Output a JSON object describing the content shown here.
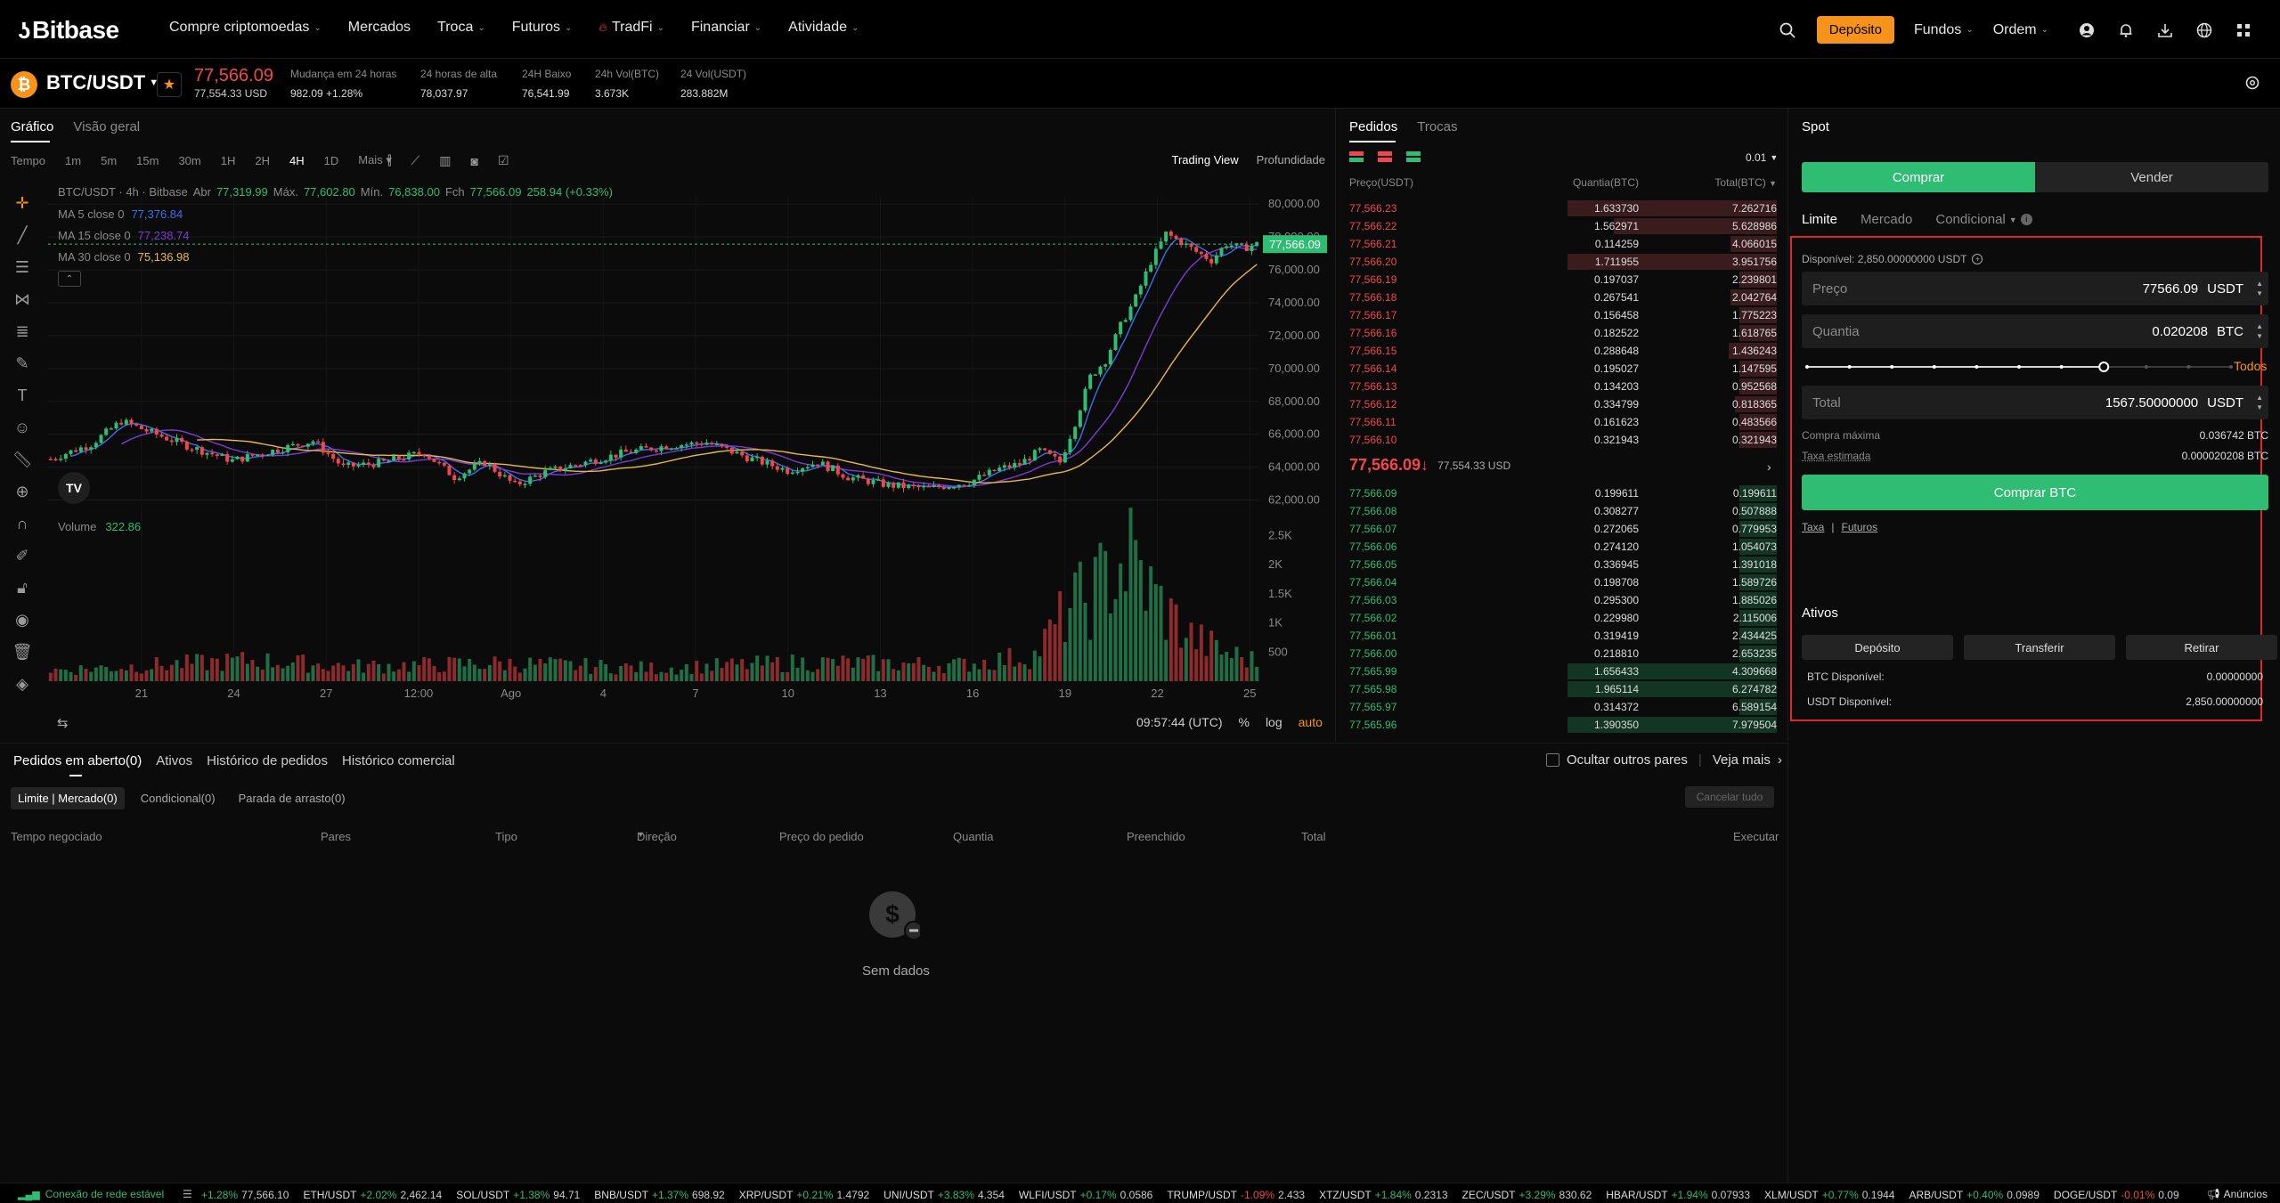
{
  "nav": {
    "logo": "Bitbase",
    "menu": [
      {
        "label": "Compre criptomoedas",
        "chevron": true
      },
      {
        "label": "Mercados",
        "chevron": false
      },
      {
        "label": "Troca",
        "chevron": true
      },
      {
        "label": "Futuros",
        "chevron": true
      },
      {
        "label": "TradFi",
        "chevron": true
      },
      {
        "label": "Financiar",
        "chevron": true
      },
      {
        "label": "Atividade",
        "chevron": true
      }
    ],
    "deposit_label": "Depósito",
    "funds_label": "Fundos",
    "order_label": "Ordem"
  },
  "ticker": {
    "pair": "BTC/USDT",
    "last_price": "77,566.09",
    "last_usd": "77,554.33 USD",
    "stats": [
      {
        "label": "Mudança em 24 horas",
        "value": "982.09 +1.28%",
        "color": "green"
      },
      {
        "label": "24 horas de alta",
        "value": "78,037.97",
        "color": "normal"
      },
      {
        "label": "24H Baixo",
        "value": "76,541.99",
        "color": "normal"
      },
      {
        "label": "24h Vol(BTC)",
        "value": "3.673K",
        "color": "normal"
      },
      {
        "label": "24 Vol(USDT)",
        "value": "283.882M",
        "color": "normal"
      }
    ]
  },
  "chart_panel": {
    "tabs": [
      "Gráfico",
      "Visão geral"
    ],
    "intervals": [
      "Tempo",
      "1m",
      "5m",
      "15m",
      "30m",
      "1H",
      "2H",
      "4H",
      "1D",
      "Mais"
    ],
    "active_interval": "4H",
    "views": [
      "Trading View",
      "Profundidade"
    ],
    "ohlc": {
      "title": "BTC/USDT · 4h · Bitbase",
      "open_label": "Abr",
      "open": "77,319.99",
      "high_label": "Máx.",
      "high": "77,602.80",
      "low_label": "Mín.",
      "low": "76,838.00",
      "close_label": "Fch",
      "close": "77,566.09",
      "change": "258.94 (+0.33%)"
    },
    "ma": [
      {
        "label": "MA 5 close 0",
        "value": "77,376.84",
        "color": "#3b6ff0"
      },
      {
        "label": "MA 15 close 0",
        "value": "77,238.74",
        "color": "#7a3bd6"
      },
      {
        "label": "MA 30 close 0",
        "value": "75,136.98",
        "color": "#e8b84a"
      }
    ],
    "volume_label": "Volume",
    "volume_value": "322.86",
    "clock": "09:57:44 (UTC)",
    "scale_options": [
      "%",
      "log",
      "auto"
    ]
  },
  "chart_data": {
    "type": "candlestick",
    "title": "BTC/USDT · 4h · Bitbase",
    "y_ticks": [
      "80,000.00",
      "78,000.00",
      "76,000.00",
      "74,000.00",
      "72,000.00",
      "70,000.00",
      "68,000.00",
      "66,000.00",
      "64,000.00",
      "62,000.00"
    ],
    "ylim": [
      61000,
      80500
    ],
    "x_ticks": [
      "21",
      "24",
      "27",
      "12:00",
      "Ago",
      "4",
      "7",
      "10",
      "13",
      "16",
      "19",
      "22",
      "25"
    ],
    "volume_ticks": [
      "2.5K",
      "2K",
      "1.5K",
      "1K",
      "500"
    ],
    "volume_lim": [
      0,
      2600
    ],
    "current_price_label": "77,566.09",
    "close_anchors": [
      [
        0,
        64500
      ],
      [
        8,
        65400
      ],
      [
        14,
        66800
      ],
      [
        20,
        66100
      ],
      [
        28,
        65200
      ],
      [
        36,
        64400
      ],
      [
        44,
        65000
      ],
      [
        52,
        65600
      ],
      [
        58,
        64000
      ],
      [
        66,
        64300
      ],
      [
        74,
        64900
      ],
      [
        80,
        63400
      ],
      [
        86,
        64300
      ],
      [
        92,
        62900
      ],
      [
        98,
        63700
      ],
      [
        106,
        64300
      ],
      [
        114,
        64900
      ],
      [
        122,
        65300
      ],
      [
        130,
        65500
      ],
      [
        138,
        64600
      ],
      [
        146,
        63800
      ],
      [
        152,
        64300
      ],
      [
        158,
        63400
      ],
      [
        166,
        62900
      ],
      [
        174,
        62700
      ],
      [
        182,
        63100
      ],
      [
        188,
        63900
      ],
      [
        192,
        64200
      ],
      [
        196,
        65000
      ],
      [
        200,
        64300
      ],
      [
        203,
        66700
      ],
      [
        206,
        69500
      ],
      [
        209,
        70500
      ],
      [
        212,
        72600
      ],
      [
        215,
        74300
      ],
      [
        218,
        76500
      ],
      [
        221,
        78200
      ],
      [
        224,
        77700
      ],
      [
        227,
        77100
      ],
      [
        230,
        76600
      ],
      [
        233,
        77600
      ],
      [
        236,
        77300
      ],
      [
        239,
        77566
      ]
    ],
    "volume_anchors": [
      [
        0,
        220
      ],
      [
        40,
        420
      ],
      [
        60,
        300
      ],
      [
        90,
        360
      ],
      [
        120,
        260
      ],
      [
        150,
        380
      ],
      [
        180,
        330
      ],
      [
        195,
        520
      ],
      [
        202,
        1500
      ],
      [
        206,
        1700
      ],
      [
        210,
        2200
      ],
      [
        214,
        2500
      ],
      [
        218,
        1800
      ],
      [
        222,
        1300
      ],
      [
        226,
        900
      ],
      [
        232,
        600
      ],
      [
        239,
        400
      ]
    ],
    "ma_periods": [
      5,
      15,
      30
    ]
  },
  "orderbook": {
    "tabs": [
      "Pedidos",
      "Trocas"
    ],
    "precision": "0.01",
    "headers": [
      "Preço(USDT)",
      "Quantia(BTC)",
      "Total(BTC)"
    ],
    "asks": [
      {
        "price": "77,566.23",
        "qty": "1.633730",
        "total": "7.262716",
        "depth": 1.0
      },
      {
        "price": "77,566.22",
        "qty": "1.562971",
        "total": "5.628986",
        "depth": 0.78
      },
      {
        "price": "77,566.21",
        "qty": "0.114259",
        "total": "4.066015",
        "depth": 0.22
      },
      {
        "price": "77,566.20",
        "qty": "1.711955",
        "total": "3.951756",
        "depth": 1.0
      },
      {
        "price": "77,566.19",
        "qty": "0.197037",
        "total": "2.239801",
        "depth": 0.18
      },
      {
        "price": "77,566.18",
        "qty": "0.267541",
        "total": "2.042764",
        "depth": 0.22
      },
      {
        "price": "77,566.17",
        "qty": "0.156458",
        "total": "1.775223",
        "depth": 0.18
      },
      {
        "price": "77,566.16",
        "qty": "0.182522",
        "total": "1.618765",
        "depth": 0.18
      },
      {
        "price": "77,566.15",
        "qty": "0.288648",
        "total": "1.436243",
        "depth": 0.23
      },
      {
        "price": "77,566.14",
        "qty": "0.195027",
        "total": "1.147595",
        "depth": 0.18
      },
      {
        "price": "77,566.13",
        "qty": "0.134203",
        "total": "0.952568",
        "depth": 0.18
      },
      {
        "price": "77,566.12",
        "qty": "0.334799",
        "total": "0.818365",
        "depth": 0.2
      },
      {
        "price": "77,566.11",
        "qty": "0.161623",
        "total": "0.483566",
        "depth": 0.18
      },
      {
        "price": "77,566.10",
        "qty": "0.321943",
        "total": "0.321943",
        "depth": 0.18
      }
    ],
    "mid_price": "77,566.09↓",
    "mid_usd": "77,554.33 USD",
    "bids": [
      {
        "price": "77,566.09",
        "qty": "0.199611",
        "total": "0.199611",
        "depth": 0.18
      },
      {
        "price": "77,566.08",
        "qty": "0.308277",
        "total": "0.507888",
        "depth": 0.18
      },
      {
        "price": "77,566.07",
        "qty": "0.272065",
        "total": "0.779953",
        "depth": 0.18
      },
      {
        "price": "77,566.06",
        "qty": "0.274120",
        "total": "1.054073",
        "depth": 0.18
      },
      {
        "price": "77,566.05",
        "qty": "0.336945",
        "total": "1.391018",
        "depth": 0.18
      },
      {
        "price": "77,566.04",
        "qty": "0.198708",
        "total": "1.589726",
        "depth": 0.18
      },
      {
        "price": "77,566.03",
        "qty": "0.295300",
        "total": "1.885026",
        "depth": 0.18
      },
      {
        "price": "77,566.02",
        "qty": "0.229980",
        "total": "2.115006",
        "depth": 0.18
      },
      {
        "price": "77,566.01",
        "qty": "0.319419",
        "total": "2.434425",
        "depth": 0.18
      },
      {
        "price": "77,566.00",
        "qty": "0.218810",
        "total": "2.653235",
        "depth": 0.18
      },
      {
        "price": "77,565.99",
        "qty": "1.656433",
        "total": "4.309668",
        "depth": 1.0
      },
      {
        "price": "77,565.98",
        "qty": "1.965114",
        "total": "6.274782",
        "depth": 1.0
      },
      {
        "price": "77,565.97",
        "qty": "0.314372",
        "total": "6.589154",
        "depth": 0.18
      },
      {
        "price": "77,565.96",
        "qty": "1.390350",
        "total": "7.979504",
        "depth": 1.0
      }
    ]
  },
  "spot": {
    "title": "Spot",
    "buy_label": "Comprar",
    "sell_label": "Vender",
    "order_types": [
      "Limite",
      "Mercado",
      "Condicional"
    ],
    "available": "Disponível: 2,850.00000000 USDT",
    "price": {
      "label": "Preço",
      "value": "77566.09",
      "unit": "USDT"
    },
    "quantity": {
      "label": "Quantia",
      "value": "0.020208",
      "unit": "BTC"
    },
    "slider_level": 0.7,
    "slider_all": "Todos",
    "total": {
      "label": "Total",
      "value": "1567.50000000",
      "unit": "USDT"
    },
    "max_buy_label": "Compra máxima",
    "max_buy_value": "0.036742 BTC",
    "fee_label": "Taxa estimada",
    "fee_value": "0.000020208 BTC",
    "submit_label": "Comprar BTC",
    "links": [
      "Taxa",
      "Futuros"
    ],
    "assets_title": "Ativos",
    "asset_buttons": [
      "Depósito",
      "Transferir",
      "Retirar"
    ],
    "btc_available_label": "BTC Disponível:",
    "btc_available_value": "0.00000000",
    "usdt_available_label": "USDT Disponível:",
    "usdt_available_value": "2,850.00000000"
  },
  "bottom": {
    "tabs": [
      "Pedidos em aberto(0)",
      "Ativos",
      "Histórico de pedidos",
      "Histórico comercial"
    ],
    "hide_pairs": "Ocultar outros pares",
    "see_more": "Veja mais",
    "subtabs": [
      "Limite | Mercado(0)",
      "Condicional(0)",
      "Parada de arrasto(0)"
    ],
    "cancel_all": "Cancelar tudo",
    "columns": [
      "Tempo negociado",
      "Pares",
      "Tipo",
      "Direção",
      "Preço do pedido",
      "Quantia",
      "Preenchido",
      "Total",
      "Executar"
    ],
    "no_data": "Sem dados"
  },
  "statusbar": {
    "connection": "Conexão de rede estável",
    "tickers": [
      {
        "sym": "",
        "chg": "+1.28%",
        "price": "77,566.10",
        "up": true
      },
      {
        "sym": "ETH/USDT",
        "chg": "+2.02%",
        "price": "2,462.14",
        "up": true
      },
      {
        "sym": "SOL/USDT",
        "chg": "+1.38%",
        "price": "94.71",
        "up": true
      },
      {
        "sym": "BNB/USDT",
        "chg": "+1.37%",
        "price": "698.92",
        "up": true
      },
      {
        "sym": "XRP/USDT",
        "chg": "+0.21%",
        "price": "1.4792",
        "up": true
      },
      {
        "sym": "UNI/USDT",
        "chg": "+3.83%",
        "price": "4.354",
        "up": true
      },
      {
        "sym": "WLFI/USDT",
        "chg": "+0.17%",
        "price": "0.0586",
        "up": true
      },
      {
        "sym": "TRUMP/USDT",
        "chg": "-1.09%",
        "price": "2.433",
        "up": false
      },
      {
        "sym": "XTZ/USDT",
        "chg": "+1.84%",
        "price": "0.2313",
        "up": true
      },
      {
        "sym": "ZEC/USDT",
        "chg": "+3.29%",
        "price": "830.62",
        "up": true
      },
      {
        "sym": "HBAR/USDT",
        "chg": "+1.94%",
        "price": "0.07933",
        "up": true
      },
      {
        "sym": "XLM/USDT",
        "chg": "+0.77%",
        "price": "0.1944",
        "up": true
      },
      {
        "sym": "ARB/USDT",
        "chg": "+0.40%",
        "price": "0.0989",
        "up": true
      },
      {
        "sym": "DOGE/USDT",
        "chg": "-0.01%",
        "price": "0.09",
        "up": false
      }
    ],
    "announcements": "Anúncios"
  },
  "colors": {
    "up": "#2ebd72",
    "down": "#f0474a",
    "accent": "#f7931a",
    "highlight": "#e02828"
  }
}
